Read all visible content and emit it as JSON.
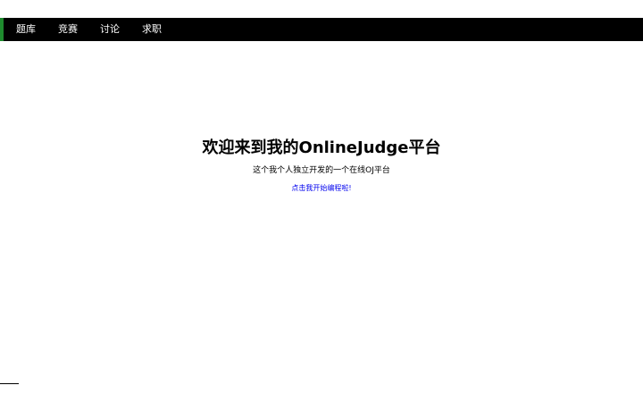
{
  "navbar": {
    "accent_color": "#1e8b2e",
    "items": [
      {
        "label": "题库"
      },
      {
        "label": "竞赛"
      },
      {
        "label": "讨论"
      },
      {
        "label": "求职"
      }
    ]
  },
  "main": {
    "title": "欢迎来到我的OnlineJudge平台",
    "subtitle": "这个我个人独立开发的一个在线OJ平台",
    "start_link": "点击我开始编程啦!"
  }
}
